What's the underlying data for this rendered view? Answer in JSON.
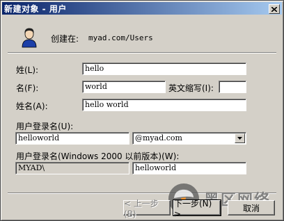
{
  "window": {
    "title": "新建对象 - 用户"
  },
  "header": {
    "create_in_label": "创建在:",
    "create_in_path": "myad.com/Users"
  },
  "form": {
    "last_name_label": "姓(L):",
    "last_name_value": "hello",
    "first_name_label": "名(F):",
    "first_name_value": "world",
    "initials_label": "英文缩写(I):",
    "initials_value": "",
    "full_name_label": "姓名(A):",
    "full_name_value": "hello world",
    "logon_name_label": "用户登录名(U):",
    "logon_name_value": "helloworld",
    "domain_suffix_value": "@myad.com",
    "pre2000_label": "用户登录名(Windows 2000 以前版本)(W):",
    "pre2000_domain_value": "MYAD\\",
    "pre2000_name_value": "helloworld"
  },
  "buttons": {
    "back_label": "< 上一步(B)",
    "next_label": "下一步(N) >",
    "cancel_label": "取消"
  },
  "watermark": {
    "text": "黑区网络"
  },
  "colors": {
    "title_start": "#0a246a",
    "title_end": "#a6caf0",
    "face": "#d4d0c8"
  },
  "icons": {
    "user": "user-icon",
    "close": "close-icon",
    "dropdown": "chevron-down-icon"
  }
}
